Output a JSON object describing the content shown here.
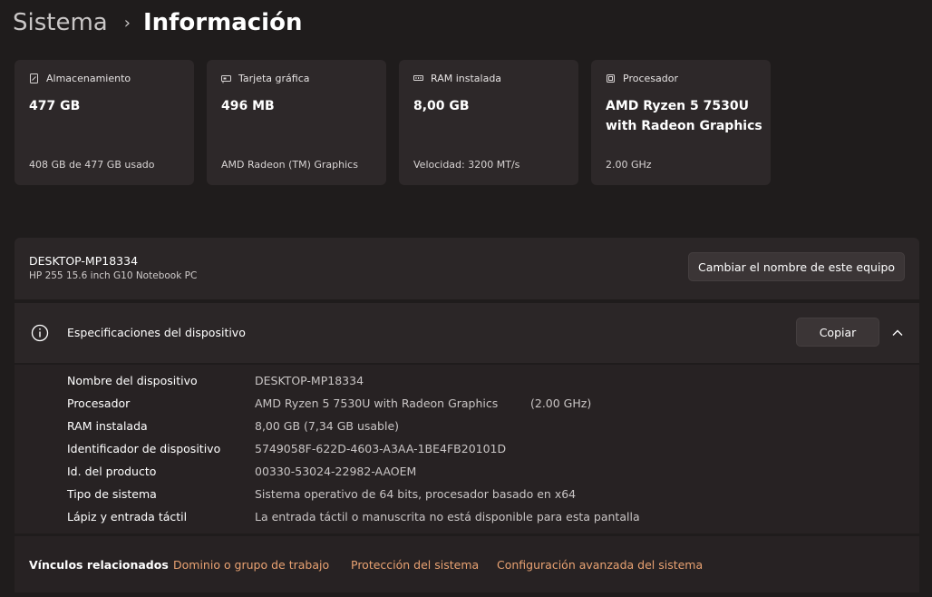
{
  "breadcrumb": {
    "root": "Sistema",
    "separator": "›",
    "current": "Información"
  },
  "cards": [
    {
      "label": "Almacenamiento",
      "value": "477 GB",
      "sub": "408 GB de 477 GB usado",
      "icon": "storage-icon"
    },
    {
      "label": "Tarjeta gráfica",
      "value": "496 MB",
      "sub": "AMD Radeon (TM) Graphics",
      "icon": "gpu-icon"
    },
    {
      "label": "RAM instalada",
      "value": "8,00 GB",
      "sub": "Velocidad: 3200 MT/s",
      "icon": "ram-icon"
    },
    {
      "label": "Procesador",
      "value_line1": "AMD Ryzen 5 7530U",
      "value_line2": "with Radeon Graphics",
      "sub": "2.00 GHz",
      "icon": "cpu-icon"
    }
  ],
  "device": {
    "name": "DESKTOP-MP18334",
    "model": "HP 255 15.6 inch G10 Notebook PC",
    "rename_label": "Cambiar el nombre de este equipo"
  },
  "specs": {
    "title": "Especificaciones del dispositivo",
    "copy_label": "Copiar",
    "rows": [
      {
        "label": "Nombre del dispositivo",
        "value": "DESKTOP-MP18334"
      },
      {
        "label": "Procesador",
        "value": "AMD Ryzen 5 7530U with Radeon Graphics",
        "extra": "(2.00 GHz)"
      },
      {
        "label": "RAM instalada",
        "value": "8,00 GB (7,34 GB usable)"
      },
      {
        "label": "Identificador de dispositivo",
        "value": "5749058F-622D-4603-A3AA-1BE4FB20101D"
      },
      {
        "label": "Id. del producto",
        "value": "00330-53024-22982-AAOEM"
      },
      {
        "label": "Tipo de sistema",
        "value": "Sistema operativo de 64 bits, procesador basado en x64"
      },
      {
        "label": "Lápiz y entrada táctil",
        "value": "La entrada táctil o manuscrita no está disponible para esta pantalla"
      }
    ]
  },
  "related": {
    "label": "Vínculos relacionados",
    "links": [
      "Dominio o grupo de trabajo",
      "Protección del sistema",
      "Configuración avanzada del sistema"
    ]
  },
  "colors": {
    "background": "#1f1c1c",
    "card": "#2d2829",
    "link": "#e9a272"
  }
}
